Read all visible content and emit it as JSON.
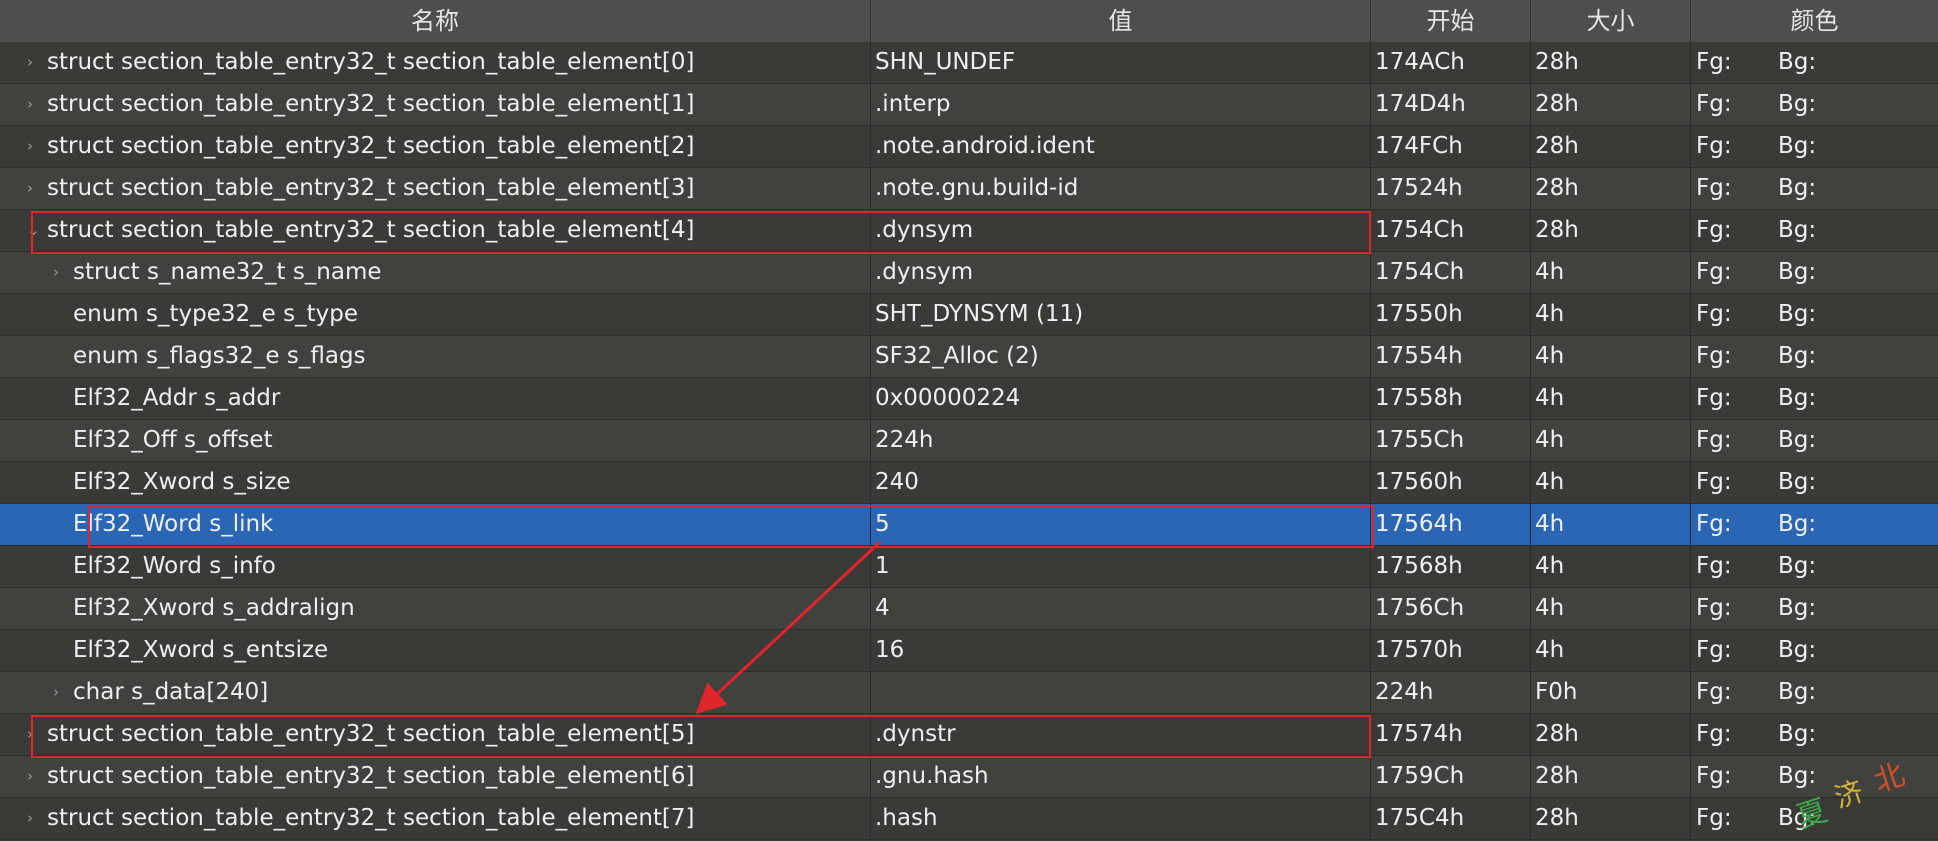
{
  "columns": {
    "name": "名称",
    "value": "值",
    "start": "开始",
    "size": "大小",
    "color": "颜色"
  },
  "rows": [
    {
      "name": "struct section_table_entry32_t section_table_element[0]",
      "value": "SHN_UNDEF",
      "start": "174ACh",
      "size": "28h",
      "fg": "Fg:",
      "bg": "Bg:",
      "indent": 0,
      "expander": "collapsed"
    },
    {
      "name": "struct section_table_entry32_t section_table_element[1]",
      "value": ".interp",
      "start": "174D4h",
      "size": "28h",
      "fg": "Fg:",
      "bg": "Bg:",
      "indent": 0,
      "expander": "collapsed"
    },
    {
      "name": "struct section_table_entry32_t section_table_element[2]",
      "value": ".note.android.ident",
      "start": "174FCh",
      "size": "28h",
      "fg": "Fg:",
      "bg": "Bg:",
      "indent": 0,
      "expander": "collapsed"
    },
    {
      "name": "struct section_table_entry32_t section_table_element[3]",
      "value": ".note.gnu.build-id",
      "start": "17524h",
      "size": "28h",
      "fg": "Fg:",
      "bg": "Bg:",
      "indent": 0,
      "expander": "collapsed"
    },
    {
      "name": "struct section_table_entry32_t section_table_element[4]",
      "value": ".dynsym",
      "start": "1754Ch",
      "size": "28h",
      "fg": "Fg:",
      "bg": "Bg:",
      "indent": 0,
      "expander": "expanded",
      "highlighted": true
    },
    {
      "name": "struct s_name32_t s_name",
      "value": ".dynsym",
      "start": "1754Ch",
      "size": "4h",
      "fg": "Fg:",
      "bg": "Bg:",
      "indent": 1,
      "expander": "collapsed"
    },
    {
      "name": "enum s_type32_e s_type",
      "value": "SHT_DYNSYM (11)",
      "start": "17550h",
      "size": "4h",
      "fg": "Fg:",
      "bg": "Bg:",
      "indent": 1,
      "expander": "none"
    },
    {
      "name": "enum s_flags32_e s_flags",
      "value": "SF32_Alloc (2)",
      "start": "17554h",
      "size": "4h",
      "fg": "Fg:",
      "bg": "Bg:",
      "indent": 1,
      "expander": "none"
    },
    {
      "name": "Elf32_Addr s_addr",
      "value": "0x00000224",
      "start": "17558h",
      "size": "4h",
      "fg": "Fg:",
      "bg": "Bg:",
      "indent": 1,
      "expander": "none"
    },
    {
      "name": "Elf32_Off s_offset",
      "value": "224h",
      "start": "1755Ch",
      "size": "4h",
      "fg": "Fg:",
      "bg": "Bg:",
      "indent": 1,
      "expander": "none"
    },
    {
      "name": "Elf32_Xword s_size",
      "value": "240",
      "start": "17560h",
      "size": "4h",
      "fg": "Fg:",
      "bg": "Bg:",
      "indent": 1,
      "expander": "none"
    },
    {
      "name": "Elf32_Word s_link",
      "value": "5",
      "start": "17564h",
      "size": "4h",
      "fg": "Fg:",
      "bg": "Bg:",
      "indent": 1,
      "expander": "none",
      "selected": true,
      "highlighted": true
    },
    {
      "name": "Elf32_Word s_info",
      "value": "1",
      "start": "17568h",
      "size": "4h",
      "fg": "Fg:",
      "bg": "Bg:",
      "indent": 1,
      "expander": "none"
    },
    {
      "name": "Elf32_Xword s_addralign",
      "value": "4",
      "start": "1756Ch",
      "size": "4h",
      "fg": "Fg:",
      "bg": "Bg:",
      "indent": 1,
      "expander": "none"
    },
    {
      "name": "Elf32_Xword s_entsize",
      "value": "16",
      "start": "17570h",
      "size": "4h",
      "fg": "Fg:",
      "bg": "Bg:",
      "indent": 1,
      "expander": "none"
    },
    {
      "name": "char s_data[240]",
      "value": "",
      "start": "224h",
      "size": "F0h",
      "fg": "Fg:",
      "bg": "Bg:",
      "indent": 1,
      "expander": "collapsed"
    },
    {
      "name": "struct section_table_entry32_t section_table_element[5]",
      "value": ".dynstr",
      "start": "17574h",
      "size": "28h",
      "fg": "Fg:",
      "bg": "Bg:",
      "indent": 0,
      "expander": "collapsed",
      "highlighted": true
    },
    {
      "name": "struct section_table_entry32_t section_table_element[6]",
      "value": ".gnu.hash",
      "start": "1759Ch",
      "size": "28h",
      "fg": "Fg:",
      "bg": "Bg:",
      "indent": 0,
      "expander": "collapsed"
    },
    {
      "name": "struct section_table_entry32_t section_table_element[7]",
      "value": ".hash",
      "start": "175C4h",
      "size": "28h",
      "fg": "Fg:",
      "bg": "Bg:",
      "indent": 0,
      "expander": "collapsed"
    }
  ],
  "annotation": {
    "color": "#e0262c",
    "from_row": 11,
    "to_row": 16
  },
  "colors": {
    "background": "#3a3a36",
    "header": "#4e4e4e",
    "selected": "#2a66b4",
    "text": "#efefef",
    "highlight": "#e0262c"
  },
  "icons": {
    "collapsed": "chevron-right-icon",
    "expanded": "chevron-down-icon"
  }
}
